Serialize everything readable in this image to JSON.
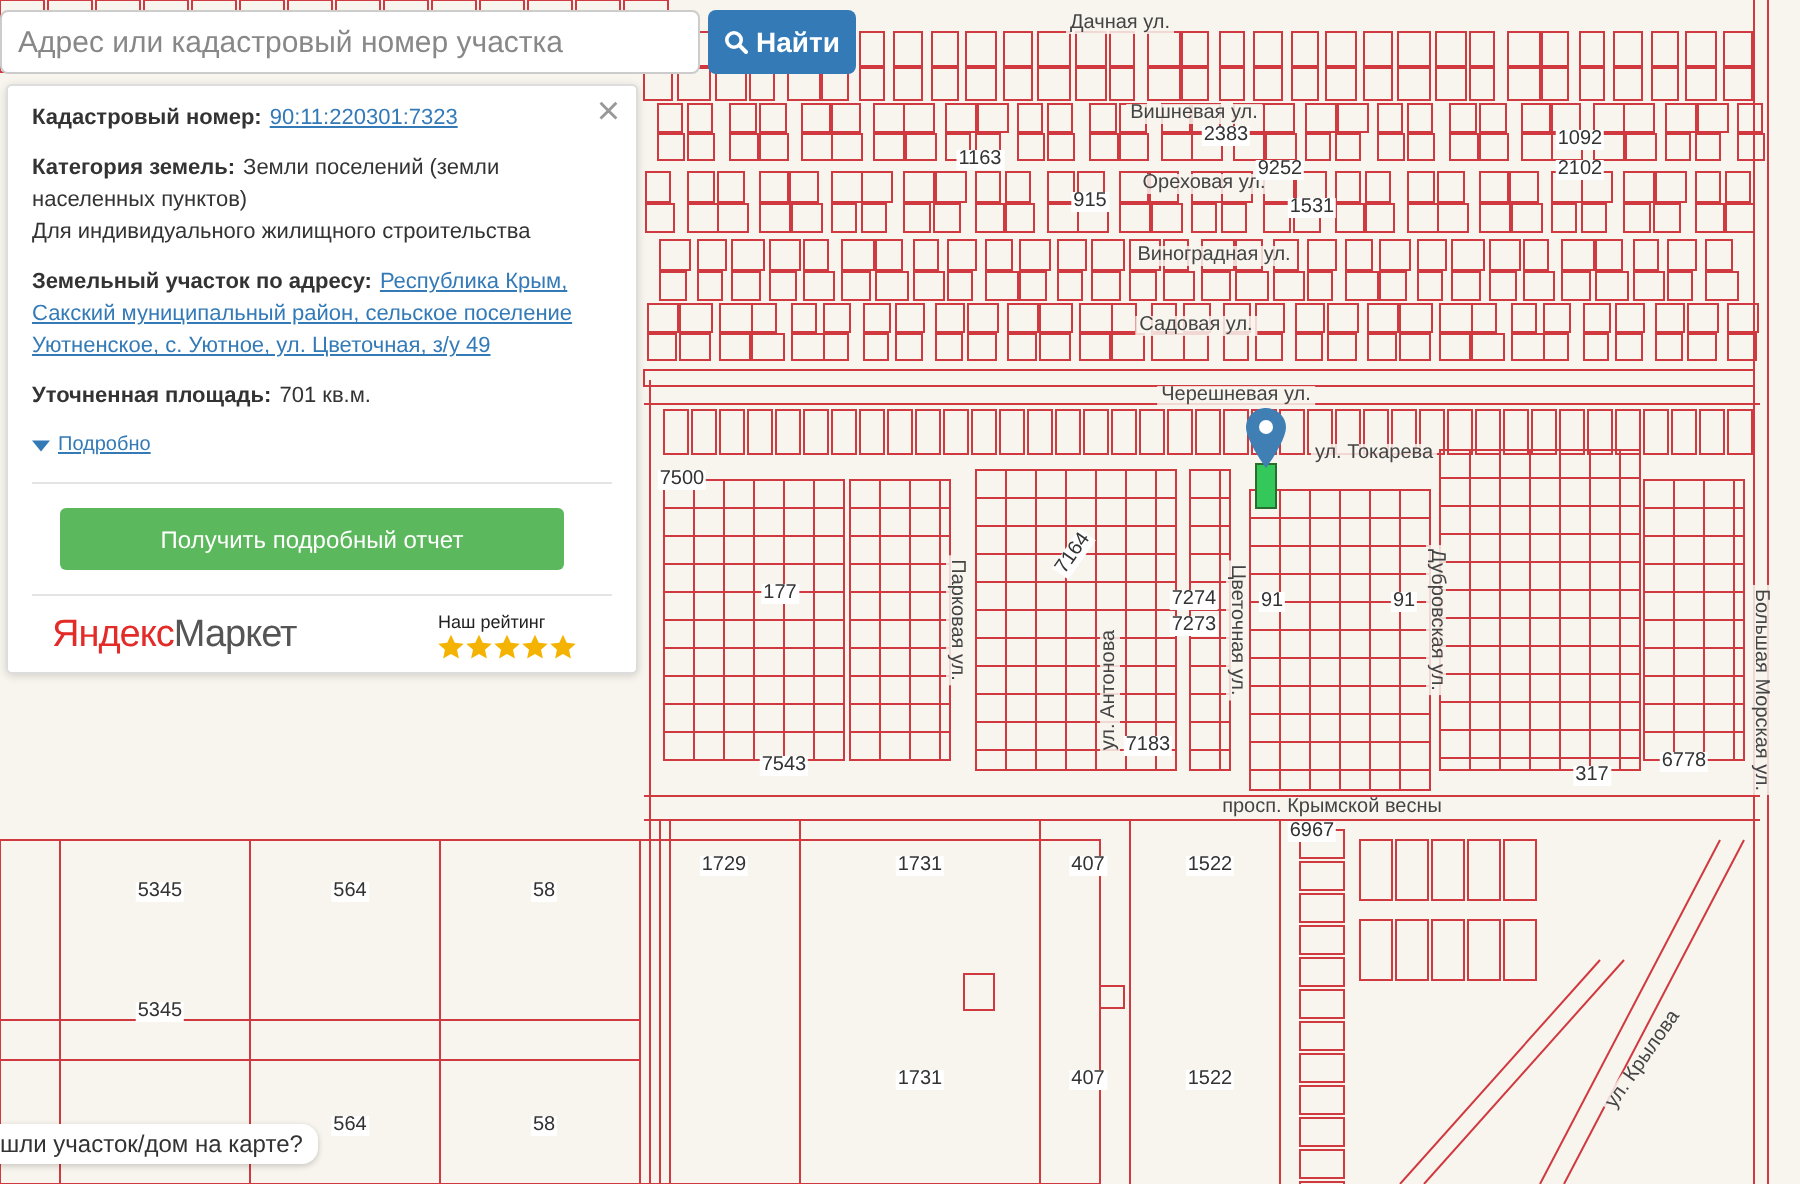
{
  "search": {
    "placeholder": "Адрес или кадастровый номер участка",
    "button": "Найти"
  },
  "info_panel": {
    "close": "×",
    "cadastral_label": "Кадастровый номер:",
    "cadastral_number": "90:11:220301:7323",
    "category_label": "Категория земель:",
    "category": "Земли поселений (земли населенных пунктов)",
    "usage": "Для индивидуального жилищного строительства",
    "address_label": "Земельный участок по адресу:",
    "address": "Республика Крым, Сакский муниципальный район, сельское поселение Уютненское, с. Уютное, ул. Цветочная, з/у 49",
    "area_label": "Уточненная площадь:",
    "area": "701 кв.м.",
    "details_link": "Подробно",
    "details_expanded": false,
    "report_button": "Получить подробный отчет",
    "market_logo_first": "Яндекс",
    "market_logo_second": "Маркет",
    "rating_label": "Наш рейтинг",
    "stars": 5
  },
  "map_labels": [
    {
      "text": "Дачная ул.",
      "kind": "street"
    },
    {
      "text": "Вишневая ул.",
      "kind": "street"
    },
    {
      "text": "Ореховая ул.",
      "kind": "street"
    },
    {
      "text": "Виноградная ул.",
      "kind": "street"
    },
    {
      "text": "Садовая ул.",
      "kind": "street"
    },
    {
      "text": "Черешневая ул.",
      "kind": "street"
    },
    {
      "text": "ул. Токарева",
      "kind": "street"
    },
    {
      "text": "Парковая ул.",
      "kind": "street"
    },
    {
      "text": "ул. Антонова",
      "kind": "street"
    },
    {
      "text": "Цветочная ул.",
      "kind": "street"
    },
    {
      "text": "Дубровская ул.",
      "kind": "street"
    },
    {
      "text": "Большая Морская ул.",
      "kind": "street"
    },
    {
      "text": "просп. Крымской весны",
      "kind": "street"
    },
    {
      "text": "ул. Крылова",
      "kind": "street"
    },
    {
      "text": "1163",
      "kind": "parcel"
    },
    {
      "text": "915",
      "kind": "parcel"
    },
    {
      "text": "2383",
      "kind": "parcel"
    },
    {
      "text": "9252",
      "kind": "parcel"
    },
    {
      "text": "1531",
      "kind": "parcel"
    },
    {
      "text": "1092",
      "kind": "parcel"
    },
    {
      "text": "2102",
      "kind": "parcel"
    },
    {
      "text": "7500",
      "kind": "parcel"
    },
    {
      "text": "177",
      "kind": "parcel"
    },
    {
      "text": "7164",
      "kind": "parcel"
    },
    {
      "text": "7274",
      "kind": "parcel"
    },
    {
      "text": "7273",
      "kind": "parcel"
    },
    {
      "text": "91",
      "kind": "parcel"
    },
    {
      "text": "91",
      "kind": "parcel"
    },
    {
      "text": "7543",
      "kind": "parcel"
    },
    {
      "text": "7183",
      "kind": "parcel"
    },
    {
      "text": "317",
      "kind": "parcel"
    },
    {
      "text": "6778",
      "kind": "parcel"
    },
    {
      "text": "6967",
      "kind": "parcel"
    },
    {
      "text": "1729",
      "kind": "parcel"
    },
    {
      "text": "1731",
      "kind": "parcel"
    },
    {
      "text": "407",
      "kind": "parcel"
    },
    {
      "text": "1522",
      "kind": "parcel"
    },
    {
      "text": "5345",
      "kind": "parcel"
    },
    {
      "text": "564",
      "kind": "parcel"
    },
    {
      "text": "58",
      "kind": "parcel"
    },
    {
      "text": "5345",
      "kind": "parcel"
    },
    {
      "text": "1731",
      "kind": "parcel"
    },
    {
      "text": "407",
      "kind": "parcel"
    },
    {
      "text": "1522",
      "kind": "parcel"
    },
    {
      "text": "564",
      "kind": "parcel"
    },
    {
      "text": "58",
      "kind": "parcel"
    }
  ],
  "selected_parcel": {
    "selected": true
  },
  "hint": "шли участок/дом на карте?"
}
